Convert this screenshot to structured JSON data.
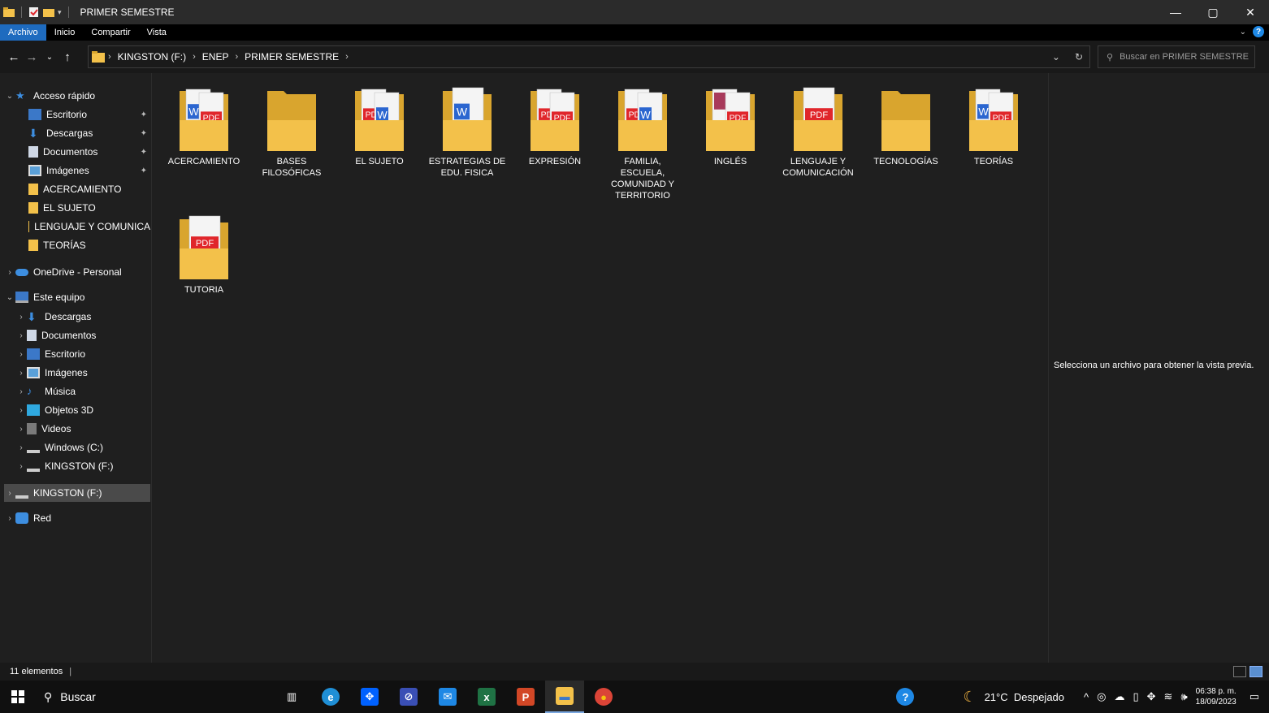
{
  "window": {
    "title": "PRIMER SEMESTRE",
    "controls": {
      "minimize": "—",
      "maximize": "▢",
      "close": "✕"
    }
  },
  "ribbon": {
    "tabs": [
      "Archivo",
      "Inicio",
      "Compartir",
      "Vista"
    ],
    "active_tab": "Archivo",
    "accent": "#1e6bbf"
  },
  "address": {
    "breadcrumbs": [
      "KINGSTON (F:)",
      "ENEP",
      "PRIMER SEMESTRE"
    ],
    "refresh_icon": "refresh-icon"
  },
  "search": {
    "placeholder": "Buscar en PRIMER SEMESTRE"
  },
  "navpane": {
    "quick_access": {
      "label": "Acceso rápido",
      "items": [
        {
          "label": "Escritorio",
          "icon": "desktop-icon",
          "pinned": true
        },
        {
          "label": "Descargas",
          "icon": "downloads-icon",
          "pinned": true
        },
        {
          "label": "Documentos",
          "icon": "documents-icon",
          "pinned": true
        },
        {
          "label": "Imágenes",
          "icon": "pictures-icon",
          "pinned": true
        },
        {
          "label": "ACERCAMIENTO",
          "icon": "folder-icon",
          "pinned": false
        },
        {
          "label": "EL SUJETO",
          "icon": "folder-icon",
          "pinned": false
        },
        {
          "label": "LENGUAJE Y COMUNICA",
          "icon": "folder-icon",
          "pinned": false
        },
        {
          "label": "TEORÍAS",
          "icon": "folder-icon",
          "pinned": false
        }
      ]
    },
    "onedrive": "OneDrive - Personal",
    "this_pc": {
      "label": "Este equipo",
      "items": [
        {
          "label": "Descargas",
          "icon": "downloads-icon"
        },
        {
          "label": "Documentos",
          "icon": "documents-icon"
        },
        {
          "label": "Escritorio",
          "icon": "desktop-icon"
        },
        {
          "label": "Imágenes",
          "icon": "pictures-icon"
        },
        {
          "label": "Música",
          "icon": "music-icon"
        },
        {
          "label": "Objetos 3D",
          "icon": "3d-objects-icon"
        },
        {
          "label": "Videos",
          "icon": "videos-icon"
        },
        {
          "label": "Windows (C:)",
          "icon": "drive-icon"
        },
        {
          "label": "KINGSTON (F:)",
          "icon": "usb-drive-icon"
        }
      ]
    },
    "kingston": "KINGSTON (F:)",
    "network": "Red"
  },
  "files": [
    {
      "label": "ACERCAMIENTO",
      "icon": "folder-word-pdf"
    },
    {
      "label": "BASES FILOSÓFICAS",
      "icon": "folder-empty"
    },
    {
      "label": "EL SUJETO",
      "icon": "folder-pdf-word"
    },
    {
      "label": "ESTRATEGIAS DE EDU. FISICA",
      "icon": "folder-word"
    },
    {
      "label": "EXPRESIÓN",
      "icon": "folder-pdf-pdf"
    },
    {
      "label": "FAMILIA, ESCUELA, COMUNIDAD Y TERRITORIO",
      "icon": "folder-pdf-word"
    },
    {
      "label": "INGLÉS",
      "icon": "folder-image-pdf"
    },
    {
      "label": "LENGUAJE Y COMUNICACIÓN",
      "icon": "folder-pdf"
    },
    {
      "label": "TECNOLOGÍAS",
      "icon": "folder-empty"
    },
    {
      "label": "TEORÍAS",
      "icon": "folder-word-pdf"
    },
    {
      "label": "TUTORIA",
      "icon": "folder-pdf"
    }
  ],
  "preview": {
    "message": "Selecciona un archivo para obtener la vista previa."
  },
  "status": {
    "count": "11 elementos"
  },
  "taskbar": {
    "search_label": "Buscar",
    "apps": [
      "task-view-icon",
      "edge-icon",
      "dropbox-icon",
      "settings-icon",
      "mail-icon",
      "excel-icon",
      "powerpoint-icon",
      "file-explorer-icon",
      "chrome-icon"
    ],
    "active_app": "file-explorer-icon",
    "weather": "21°C  Despejado",
    "time": "06:38 p. m.",
    "date": "18/09/2023"
  },
  "colors": {
    "folder": "#f3c14a",
    "folder_dark": "#d9a52e",
    "pdf": "#e0262b",
    "word": "#2b66d0",
    "background": "#1f1f1f"
  }
}
